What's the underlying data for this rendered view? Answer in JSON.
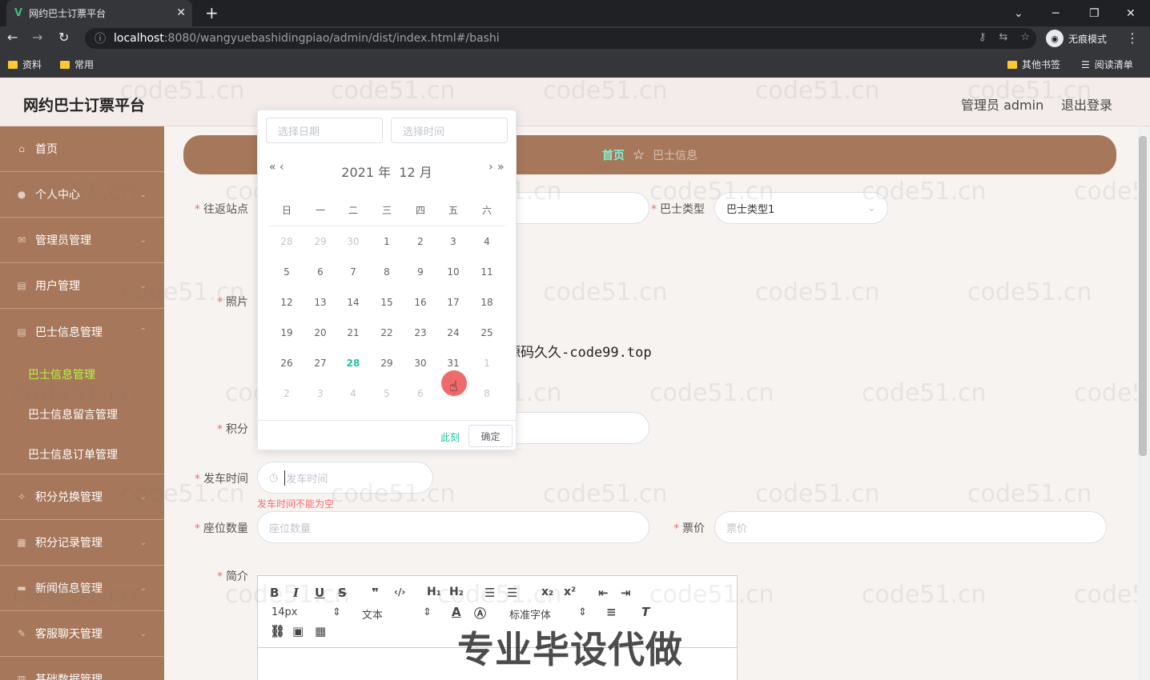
{
  "browser": {
    "tab_title": "网约巴士订票平台",
    "tab_close": "✕",
    "new_tab": "+",
    "url_host": "localhost",
    "url_path": ":8080/wangyuebashidingpiao/admin/dist/index.html#/bashi",
    "profile_label": "无痕模式",
    "bookmarks": [
      "资料",
      "常用"
    ],
    "other_bookmarks": "其他书签",
    "reading_list": "阅读清单"
  },
  "header": {
    "title": "网约巴士订票平台",
    "admin": "管理员 admin",
    "logout": "退出登录"
  },
  "sidebar": {
    "items": [
      {
        "label": "首页",
        "icon": "home-icon"
      },
      {
        "label": "个人中心",
        "icon": "user-icon"
      },
      {
        "label": "管理员管理",
        "icon": "mail-icon"
      },
      {
        "label": "用户管理",
        "icon": "doc-icon"
      },
      {
        "label": "巴士信息管理",
        "icon": "doc-icon"
      }
    ],
    "sub_items": [
      "巴士信息管理",
      "巴士信息留言管理",
      "巴士信息订单管理"
    ],
    "items_after": [
      {
        "label": "积分兑换管理",
        "icon": "gift-icon"
      },
      {
        "label": "积分记录管理",
        "icon": "grid-icon"
      },
      {
        "label": "新闻信息管理",
        "icon": "news-icon"
      },
      {
        "label": "客服聊天管理",
        "icon": "chat-icon"
      },
      {
        "label": "基础数据管理",
        "icon": "data-icon"
      }
    ]
  },
  "breadcrumb": {
    "home": "首页",
    "current": "巴士信息"
  },
  "form": {
    "round_trip_label": "往返站点",
    "bus_type_label": "巴士类型",
    "bus_type_value": "巴士类型1",
    "photo_label": "照片",
    "points_label": "积分",
    "departure_label": "发车时间",
    "departure_placeholder": "发车时间",
    "departure_error": "发车时间不能为空",
    "seats_label": "座位数量",
    "seats_placeholder": "座位数量",
    "price_label": "票价",
    "price_placeholder": "票价",
    "intro_label": "简介"
  },
  "editor": {
    "font_size": "14px",
    "text_style": "文本",
    "font_family": "标准字体"
  },
  "datepicker": {
    "date_placeholder": "选择日期",
    "time_placeholder": "选择时间",
    "year": "2021 年",
    "month": "12 月",
    "weekdays": [
      "日",
      "一",
      "二",
      "三",
      "四",
      "五",
      "六"
    ],
    "weeks": [
      [
        "28",
        "29",
        "30",
        "1",
        "2",
        "3",
        "4"
      ],
      [
        "5",
        "6",
        "7",
        "8",
        "9",
        "10",
        "11"
      ],
      [
        "12",
        "13",
        "14",
        "15",
        "16",
        "17",
        "18"
      ],
      [
        "19",
        "20",
        "21",
        "22",
        "23",
        "24",
        "25"
      ],
      [
        "26",
        "27",
        "28",
        "29",
        "30",
        "31",
        "1"
      ],
      [
        "2",
        "3",
        "4",
        "5",
        "6",
        "7",
        "8"
      ]
    ],
    "today": "28",
    "now_label": "此刻",
    "confirm_label": "确定"
  },
  "overlay": {
    "code_text": "源码久久-code99.top",
    "big_text": "专业毕设代做",
    "watermark": "code51.cn"
  }
}
